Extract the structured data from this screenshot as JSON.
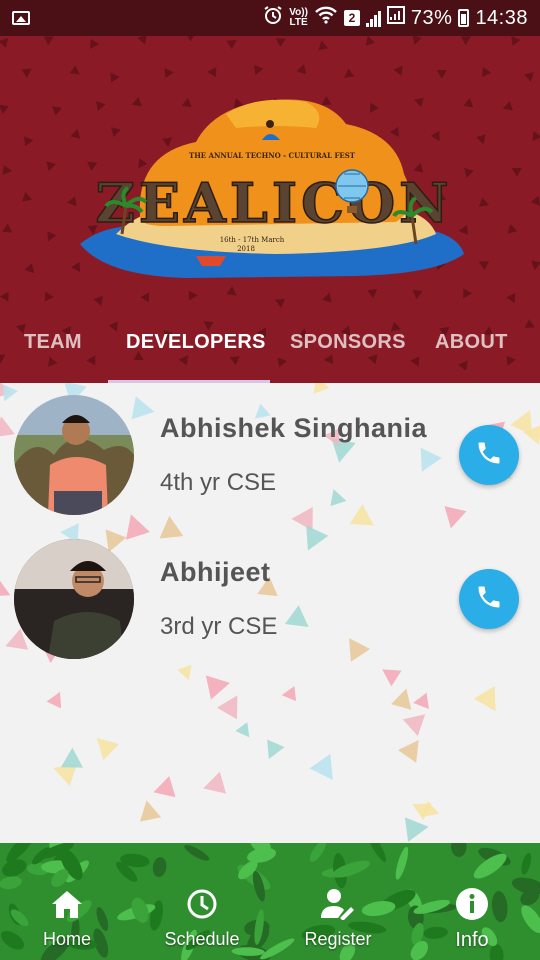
{
  "status_bar": {
    "volte_top": "Vo))",
    "volte_bottom": "LTE",
    "sim_badge": "2",
    "battery_percent": "73%",
    "time": "14:38",
    "icons": [
      "image-icon",
      "alarm-icon",
      "wifi-icon",
      "signal-icon",
      "battery-icon"
    ]
  },
  "header": {
    "logo": {
      "wordmark": "ZEALICON",
      "tagline": "THE ANNUAL TECHNO - CULTURAL FEST",
      "dates": "16th - 17th March",
      "year": "2018"
    },
    "background_color": "#8a1b26"
  },
  "tabs": [
    {
      "label": "TEAM",
      "active": false
    },
    {
      "label": "DEVELOPERS",
      "active": true
    },
    {
      "label": "SPONSORS",
      "active": false
    },
    {
      "label": "ABOUT",
      "active": false
    }
  ],
  "developers": [
    {
      "name": "Abhishek Singhania",
      "year": "4th yr CSE",
      "icon": "phone-icon"
    },
    {
      "name": "Abhijeet",
      "year": "3rd yr CSE",
      "icon": "phone-icon"
    }
  ],
  "bottom_nav": [
    {
      "label": "Home",
      "icon": "home-icon",
      "active": false
    },
    {
      "label": "Schedule",
      "icon": "clock-icon",
      "active": false
    },
    {
      "label": "Register",
      "icon": "add-user-icon",
      "active": false
    },
    {
      "label": "Info",
      "icon": "info-icon",
      "active": true
    }
  ],
  "colors": {
    "header": "#8a1b26",
    "accent": "#2baee8",
    "indicator": "#d7c4e6",
    "leaves": "#2f8f2f"
  }
}
